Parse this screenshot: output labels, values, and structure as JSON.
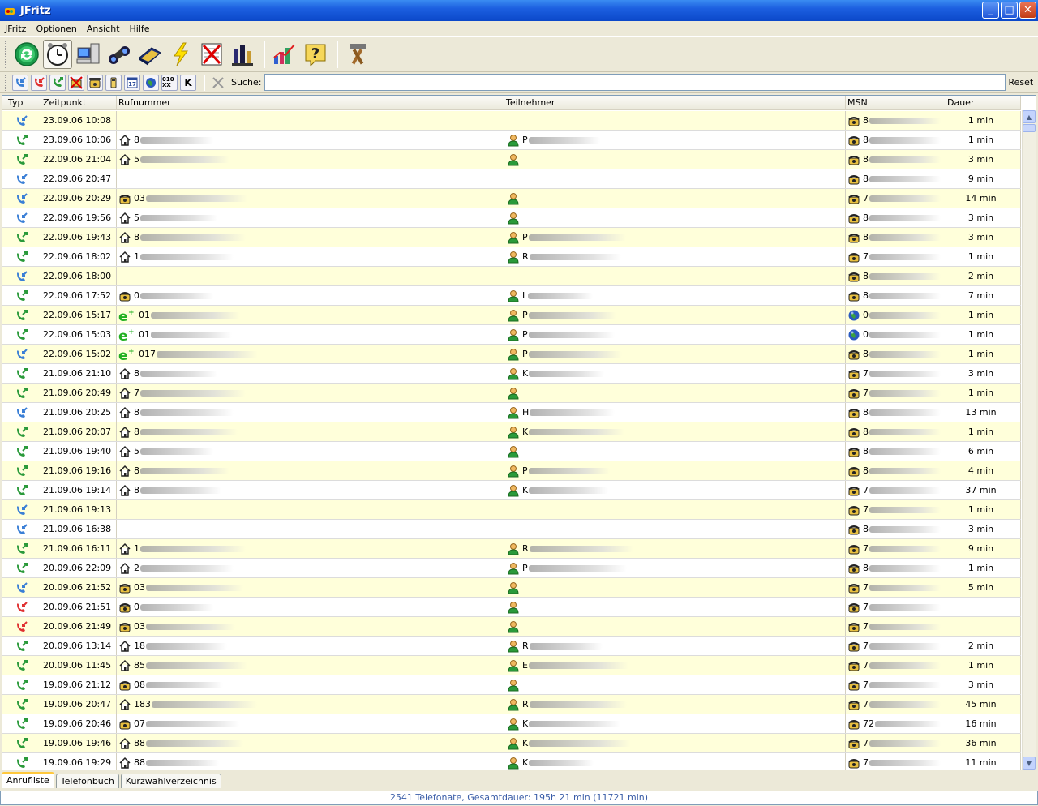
{
  "window": {
    "title": "JFritz"
  },
  "menu": [
    "JFritz",
    "Optionen",
    "Ansicht",
    "Hilfe"
  ],
  "toolbar": {
    "buttons": [
      "refresh-icon",
      "alarm-clock-icon",
      "computer-icon",
      "binoculars-icon",
      "phonebook-icon",
      "lightning-icon",
      "delete-list-icon",
      "export-icon",
      "statistics-icon",
      "help-icon",
      "settings-tools-icon"
    ]
  },
  "filterbar": {
    "filters": [
      "call-in-icon",
      "call-out-icon",
      "call-missed-icon",
      "no-number-icon",
      "fixed-line-icon",
      "mobile-icon",
      "date-icon",
      "sip-icon",
      "free-call-icon",
      "k-filter-icon"
    ],
    "k_label": "K",
    "sip_label": "010 XX",
    "search_label": "Suche:",
    "search_value": "",
    "reset_label": "Reset"
  },
  "table": {
    "headers": [
      "Typ",
      "Zeitpunkt",
      "Rufnummer",
      "Teilnehmer",
      "MSN",
      "Dauer"
    ],
    "rows": [
      {
        "type": "in",
        "time": "23.09.06 10:08",
        "num_icon": "",
        "num": "",
        "who_icon": false,
        "who": "",
        "msn_icon": "phone",
        "msn": "8",
        "dauer": "1 min"
      },
      {
        "type": "out",
        "time": "23.09.06 10:06",
        "num_icon": "home",
        "num": "8",
        "who_icon": true,
        "who": "P",
        "msn_icon": "phone",
        "msn": "8",
        "dauer": "1 min"
      },
      {
        "type": "out",
        "time": "22.09.06 21:04",
        "num_icon": "home",
        "num": "5",
        "who_icon": true,
        "who": "",
        "msn_icon": "phone",
        "msn": "8",
        "dauer": "3 min"
      },
      {
        "type": "in",
        "time": "22.09.06 20:47",
        "num_icon": "",
        "num": "",
        "who_icon": false,
        "who": "",
        "msn_icon": "phone",
        "msn": "8",
        "dauer": "9 min"
      },
      {
        "type": "in",
        "time": "22.09.06 20:29",
        "num_icon": "phone",
        "num": "03",
        "who_icon": true,
        "who": "",
        "msn_icon": "phone",
        "msn": "7",
        "dauer": "14 min"
      },
      {
        "type": "in",
        "time": "22.09.06 19:56",
        "num_icon": "home",
        "num": "5",
        "who_icon": true,
        "who": "",
        "msn_icon": "phone",
        "msn": "8",
        "dauer": "3 min"
      },
      {
        "type": "out",
        "time": "22.09.06 19:43",
        "num_icon": "home",
        "num": "8",
        "who_icon": true,
        "who": "P",
        "msn_icon": "phone",
        "msn": "8",
        "dauer": "3 min"
      },
      {
        "type": "out",
        "time": "22.09.06 18:02",
        "num_icon": "home",
        "num": "1",
        "who_icon": true,
        "who": "R",
        "msn_icon": "phone",
        "msn": "7",
        "dauer": "1 min"
      },
      {
        "type": "in",
        "time": "22.09.06 18:00",
        "num_icon": "",
        "num": "",
        "who_icon": false,
        "who": "",
        "msn_icon": "phone",
        "msn": "8",
        "dauer": "2 min"
      },
      {
        "type": "out",
        "time": "22.09.06 17:52",
        "num_icon": "phone",
        "num": "0",
        "who_icon": true,
        "who": "L",
        "msn_icon": "phone",
        "msn": "8",
        "dauer": "7 min"
      },
      {
        "type": "out",
        "time": "22.09.06 15:17",
        "num_icon": "eplus",
        "num": "01",
        "who_icon": true,
        "who": "P",
        "msn_icon": "globe",
        "msn": "0",
        "dauer": "1 min"
      },
      {
        "type": "out",
        "time": "22.09.06 15:03",
        "num_icon": "eplus",
        "num": "01",
        "who_icon": true,
        "who": "P",
        "msn_icon": "globe",
        "msn": "0",
        "dauer": "1 min"
      },
      {
        "type": "in",
        "time": "22.09.06 15:02",
        "num_icon": "eplus",
        "num": "017",
        "who_icon": true,
        "who": "P",
        "msn_icon": "phone",
        "msn": "8",
        "dauer": "1 min"
      },
      {
        "type": "out",
        "time": "21.09.06 21:10",
        "num_icon": "home",
        "num": "8",
        "who_icon": true,
        "who": "K",
        "msn_icon": "phone",
        "msn": "7",
        "dauer": "3 min"
      },
      {
        "type": "out",
        "time": "21.09.06 20:49",
        "num_icon": "home",
        "num": "7",
        "who_icon": true,
        "who": "",
        "msn_icon": "phone",
        "msn": "7",
        "dauer": "1 min"
      },
      {
        "type": "in",
        "time": "21.09.06 20:25",
        "num_icon": "home",
        "num": "8",
        "who_icon": true,
        "who": "H",
        "msn_icon": "phone",
        "msn": "8",
        "dauer": "13 min"
      },
      {
        "type": "out",
        "time": "21.09.06 20:07",
        "num_icon": "home",
        "num": "8",
        "who_icon": true,
        "who": "K",
        "msn_icon": "phone",
        "msn": "8",
        "dauer": "1 min"
      },
      {
        "type": "out",
        "time": "21.09.06 19:40",
        "num_icon": "home",
        "num": "5",
        "who_icon": true,
        "who": "",
        "msn_icon": "phone",
        "msn": "8",
        "dauer": "6 min"
      },
      {
        "type": "out",
        "time": "21.09.06 19:16",
        "num_icon": "home",
        "num": "8",
        "who_icon": true,
        "who": "P",
        "msn_icon": "phone",
        "msn": "8",
        "dauer": "4 min"
      },
      {
        "type": "out",
        "time": "21.09.06 19:14",
        "num_icon": "home",
        "num": "8",
        "who_icon": true,
        "who": "K",
        "msn_icon": "phone",
        "msn": "7",
        "dauer": "37 min"
      },
      {
        "type": "in",
        "time": "21.09.06 19:13",
        "num_icon": "",
        "num": "",
        "who_icon": false,
        "who": "",
        "msn_icon": "phone",
        "msn": "7",
        "dauer": "1 min"
      },
      {
        "type": "in",
        "time": "21.09.06 16:38",
        "num_icon": "",
        "num": "",
        "who_icon": false,
        "who": "",
        "msn_icon": "phone",
        "msn": "8",
        "dauer": "3 min"
      },
      {
        "type": "out",
        "time": "21.09.06 16:11",
        "num_icon": "home",
        "num": "1",
        "who_icon": true,
        "who": "R",
        "msn_icon": "phone",
        "msn": "7",
        "dauer": "9 min"
      },
      {
        "type": "out",
        "time": "20.09.06 22:09",
        "num_icon": "home",
        "num": "2",
        "who_icon": true,
        "who": "P",
        "msn_icon": "phone",
        "msn": "8",
        "dauer": "1 min"
      },
      {
        "type": "in",
        "time": "20.09.06 21:52",
        "num_icon": "phone",
        "num": "03",
        "who_icon": true,
        "who": "",
        "msn_icon": "phone",
        "msn": "7",
        "dauer": "5 min"
      },
      {
        "type": "missed",
        "time": "20.09.06 21:51",
        "num_icon": "phone",
        "num": "0",
        "who_icon": true,
        "who": "",
        "msn_icon": "phone",
        "msn": "7",
        "dauer": ""
      },
      {
        "type": "missed",
        "time": "20.09.06 21:49",
        "num_icon": "phone",
        "num": "03",
        "who_icon": true,
        "who": "",
        "msn_icon": "phone",
        "msn": "7",
        "dauer": ""
      },
      {
        "type": "out",
        "time": "20.09.06 13:14",
        "num_icon": "home",
        "num": "18",
        "who_icon": true,
        "who": "R",
        "msn_icon": "phone",
        "msn": "7",
        "dauer": "2 min"
      },
      {
        "type": "out",
        "time": "20.09.06 11:45",
        "num_icon": "home",
        "num": "85",
        "who_icon": true,
        "who": "E",
        "msn_icon": "phone",
        "msn": "7",
        "dauer": "1 min"
      },
      {
        "type": "out",
        "time": "19.09.06 21:12",
        "num_icon": "phone",
        "num": "08",
        "who_icon": true,
        "who": "",
        "msn_icon": "phone",
        "msn": "7",
        "dauer": "3 min"
      },
      {
        "type": "out",
        "time": "19.09.06 20:47",
        "num_icon": "home",
        "num": "183",
        "who_icon": true,
        "who": "R",
        "msn_icon": "phone",
        "msn": "7",
        "dauer": "45 min"
      },
      {
        "type": "out",
        "time": "19.09.06 20:46",
        "num_icon": "phone",
        "num": "07",
        "who_icon": true,
        "who": "K",
        "msn_icon": "phone",
        "msn": "72",
        "dauer": "16 min"
      },
      {
        "type": "out",
        "time": "19.09.06 19:46",
        "num_icon": "home",
        "num": "88",
        "who_icon": true,
        "who": "K",
        "msn_icon": "phone",
        "msn": "7",
        "dauer": "36 min"
      },
      {
        "type": "out",
        "time": "19.09.06 19:29",
        "num_icon": "home",
        "num": "88",
        "who_icon": true,
        "who": "K",
        "msn_icon": "phone",
        "msn": "7",
        "dauer": "11 min"
      }
    ]
  },
  "tabs": [
    "Anrufliste",
    "Telefonbuch",
    "Kurzwahlverzeichnis"
  ],
  "status": "2541 Telefonate, Gesamtdauer: 195h 21 min  (11721 min)",
  "colors": {
    "row_alt": "#FFFFDA",
    "title_bar": "#0B48C9",
    "status_text": "#3B5EA8"
  }
}
